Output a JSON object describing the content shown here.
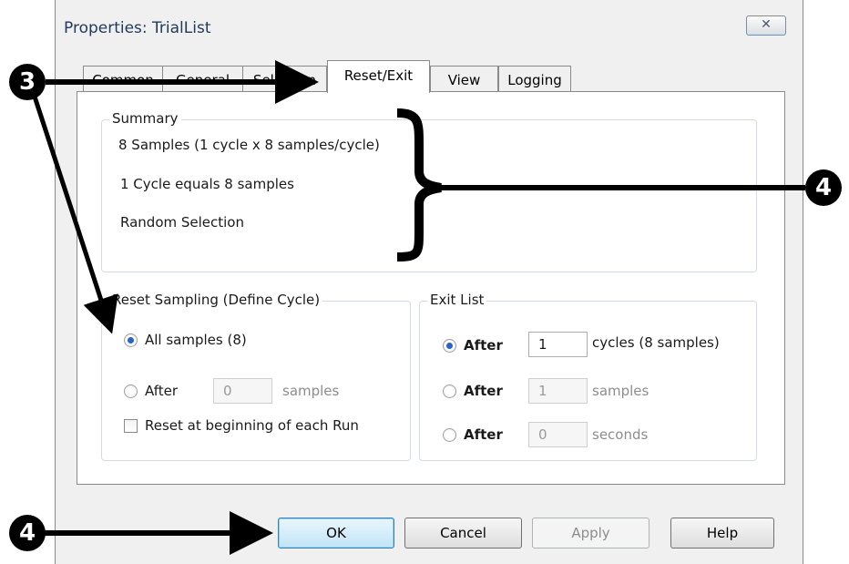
{
  "window": {
    "title": "Properties: TrialList",
    "close_glyph": "✕"
  },
  "tabs": [
    {
      "label": "Common"
    },
    {
      "label": "General"
    },
    {
      "label": "Selection"
    },
    {
      "label": "Reset/Exit",
      "active": true
    },
    {
      "label": "View"
    },
    {
      "label": "Logging"
    }
  ],
  "summary": {
    "legend": "Summary",
    "lines": [
      "8 Samples (1 cycle x 8 samples/cycle)",
      "1 Cycle equals 8 samples",
      "Random Selection"
    ]
  },
  "reset_sampling": {
    "legend": "Reset Sampling (Define Cycle)",
    "all_samples_label": "All samples (8)",
    "all_samples_checked": true,
    "after_label": "After",
    "after_value": "0",
    "after_unit": "samples",
    "reset_checkbox_label": "Reset at beginning of each Run",
    "reset_checkbox_checked": false
  },
  "exit_list": {
    "legend": "Exit List",
    "options": [
      {
        "label": "After",
        "value": "1",
        "unit": "cycles (8 samples)",
        "checked": true
      },
      {
        "label": "After",
        "value": "1",
        "unit": "samples",
        "checked": false
      },
      {
        "label": "After",
        "value": "0",
        "unit": "seconds",
        "checked": false
      }
    ]
  },
  "buttons": {
    "ok": "OK",
    "cancel": "Cancel",
    "apply": "Apply",
    "help": "Help"
  },
  "callouts": {
    "tabs_marker": "3",
    "summary_marker": "4",
    "ok_marker": "4"
  },
  "colors": {
    "accent": "#2a62c8",
    "callout": "#000000"
  }
}
